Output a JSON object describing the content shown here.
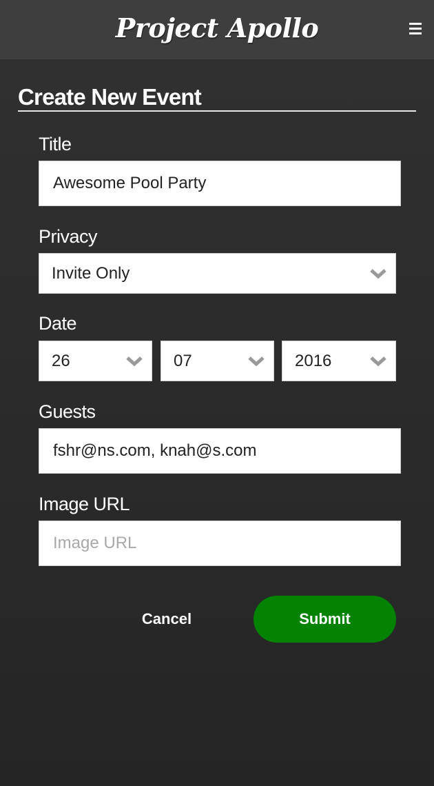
{
  "header": {
    "brand": "Project Apollo",
    "menu_icon": "hamburger-menu-icon"
  },
  "form": {
    "heading": "Create New Event",
    "title": {
      "label": "Title",
      "value": "Awesome Pool Party"
    },
    "privacy": {
      "label": "Privacy",
      "selected": "Invite Only",
      "icon": "chevron-down-icon"
    },
    "date": {
      "label": "Date",
      "day": "26",
      "month": "07",
      "year": "2016"
    },
    "guests": {
      "label": "Guests",
      "value": "fshr@ns.com, knah@s.com"
    },
    "image_url": {
      "label": "Image URL",
      "value": "",
      "placeholder": "Image URL"
    },
    "actions": {
      "cancel": "Cancel",
      "submit": "Submit"
    }
  },
  "colors": {
    "header_bg": "#3e3e3e",
    "page_bg": "#2a2a2a",
    "submit_bg": "#038203",
    "chevron": "#9a9a9a"
  }
}
